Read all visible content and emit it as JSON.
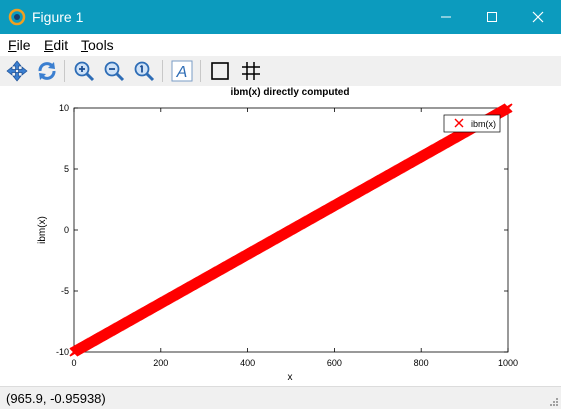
{
  "window": {
    "title": "Figure 1"
  },
  "menu": [
    {
      "first": "F",
      "rest": "ile"
    },
    {
      "first": "E",
      "rest": "dit"
    },
    {
      "first": "T",
      "rest": "ools"
    }
  ],
  "toolbar": {
    "buttons": [
      "pan-icon",
      "rotate-icon",
      "zoom-in-icon",
      "zoom-out-icon",
      "zoom-reset-icon",
      "text-insert-icon",
      "axes-box-toggle-icon",
      "grid-toggle-icon"
    ]
  },
  "colors": {
    "titlebar": "#0c9bbe",
    "series": "#ff0000"
  },
  "chart_data": {
    "type": "line",
    "title": "ibm(x) directly computed",
    "xlabel": "x",
    "ylabel": "ibm(x)",
    "xlim": [
      0,
      1000
    ],
    "ylim": [
      -10,
      10
    ],
    "xticks": [
      0,
      200,
      400,
      600,
      800,
      1000
    ],
    "yticks": [
      -10,
      -5,
      0,
      5,
      10
    ],
    "grid": false,
    "legend": "top-right",
    "series": [
      {
        "name": "ibm(x)",
        "marker": "x",
        "color": "#ff0000",
        "x": [
          0,
          1000
        ],
        "y": [
          -10,
          10
        ]
      }
    ]
  },
  "status": {
    "coords": "(965.9, -0.95938)"
  }
}
